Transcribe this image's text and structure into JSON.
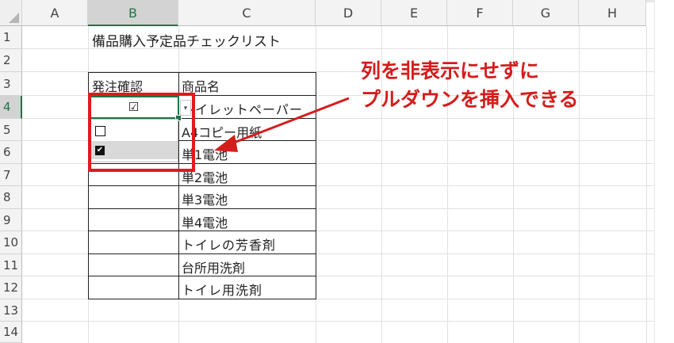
{
  "columns": [
    "A",
    "B",
    "C",
    "D",
    "E",
    "F",
    "G",
    "H"
  ],
  "rows": [
    "1",
    "2",
    "3",
    "4",
    "5",
    "6",
    "7",
    "8",
    "9",
    "10",
    "11",
    "12",
    "13",
    "14"
  ],
  "selected": {
    "column": "B",
    "row": "4"
  },
  "sheet_title": "備品購入予定品チェックリスト",
  "table": {
    "header_b": "発注確認",
    "header_c": "商品名",
    "items": [
      "トイレットペーパー",
      "A4コピー用紙",
      "単1電池",
      "単2電池",
      "単3電池",
      "単4電池",
      "トイレの芳香剤",
      "台所用洗剤",
      "トイレ用洗剤"
    ]
  },
  "active_cell_value": "☑",
  "dropdown": {
    "button_icon": "dropdown-arrow-icon",
    "options": [
      {
        "icon": "checkbox-empty-icon",
        "glyph": "☐"
      },
      {
        "icon": "checkbox-checked-icon",
        "glyph": "✔"
      }
    ]
  },
  "annotation": {
    "line1": "列を非表示にせずに",
    "line2": "プルダウンを挿入できる",
    "color": "#d51c1c"
  },
  "colors": {
    "accent": "#217346",
    "highlight_box": "#e11a1a"
  }
}
